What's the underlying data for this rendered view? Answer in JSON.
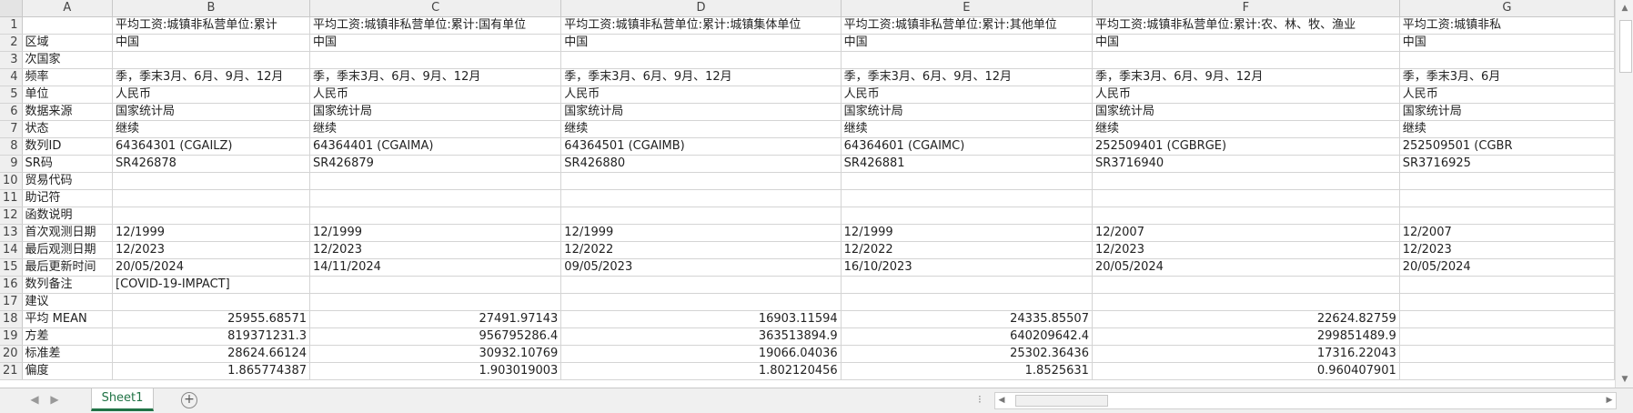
{
  "columns": [
    "A",
    "B",
    "C",
    "D",
    "E",
    "F",
    "G"
  ],
  "rows": [
    {
      "n": "1",
      "cells": [
        "",
        "平均工资:城镇非私营单位:累计",
        "平均工资:城镇非私营单位:累计:国有单位",
        "平均工资:城镇非私营单位:累计:城镇集体单位",
        "平均工资:城镇非私营单位:累计:其他单位",
        "平均工资:城镇非私营单位:累计:农、林、牧、渔业",
        "平均工资:城镇非私"
      ]
    },
    {
      "n": "2",
      "cells": [
        "区域",
        "中国",
        "中国",
        "中国",
        "中国",
        "中国",
        "中国"
      ]
    },
    {
      "n": "3",
      "cells": [
        "次国家",
        "",
        "",
        "",
        "",
        "",
        ""
      ]
    },
    {
      "n": "4",
      "cells": [
        "频率",
        "季，季末3月、6月、9月、12月",
        "季，季末3月、6月、9月、12月",
        "季，季末3月、6月、9月、12月",
        "季，季末3月、6月、9月、12月",
        "季，季末3月、6月、9月、12月",
        "季，季末3月、6月"
      ]
    },
    {
      "n": "5",
      "cells": [
        "单位",
        "人民币",
        "人民币",
        "人民币",
        "人民币",
        "人民币",
        "人民币"
      ]
    },
    {
      "n": "6",
      "cells": [
        "数据来源",
        "国家统计局",
        "国家统计局",
        "国家统计局",
        "国家统计局",
        "国家统计局",
        "国家统计局"
      ]
    },
    {
      "n": "7",
      "cells": [
        "状态",
        "继续",
        "继续",
        "继续",
        "继续",
        "继续",
        "继续"
      ]
    },
    {
      "n": "8",
      "cells": [
        "数列ID",
        "64364301 (CGAILZ)",
        "64364401 (CGAIMA)",
        "64364501 (CGAIMB)",
        "64364601 (CGAIMC)",
        "252509401 (CGBRGE)",
        "252509501 (CGBR"
      ]
    },
    {
      "n": "9",
      "cells": [
        "SR码",
        "SR426878",
        "SR426879",
        "SR426880",
        "SR426881",
        "SR3716940",
        "SR3716925"
      ]
    },
    {
      "n": "10",
      "cells": [
        "贸易代码",
        "",
        "",
        "",
        "",
        "",
        ""
      ]
    },
    {
      "n": "11",
      "cells": [
        "助记符",
        "",
        "",
        "",
        "",
        "",
        ""
      ]
    },
    {
      "n": "12",
      "cells": [
        "函数说明",
        "",
        "",
        "",
        "",
        "",
        ""
      ]
    },
    {
      "n": "13",
      "cells": [
        "首次观测日期",
        "12/1999",
        "12/1999",
        "12/1999",
        "12/1999",
        "12/2007",
        "12/2007"
      ]
    },
    {
      "n": "14",
      "cells": [
        "最后观测日期",
        "12/2023",
        "12/2023",
        "12/2022",
        "12/2022",
        "12/2023",
        "12/2023"
      ]
    },
    {
      "n": "15",
      "cells": [
        "最后更新时间",
        "20/05/2024",
        "14/11/2024",
        "09/05/2023",
        "16/10/2023",
        "20/05/2024",
        "20/05/2024"
      ]
    },
    {
      "n": "16",
      "cells": [
        "数列备注",
        "[COVID-19-IMPACT]",
        "",
        "",
        "",
        "",
        ""
      ]
    },
    {
      "n": "17",
      "cells": [
        "建议",
        "",
        "",
        "",
        "",
        "",
        ""
      ]
    },
    {
      "n": "18",
      "cells": [
        "平均 MEAN",
        "25955.68571",
        "27491.97143",
        "16903.11594",
        "24335.85507",
        "22624.82759",
        ""
      ]
    },
    {
      "n": "19",
      "cells": [
        "方差",
        "819371231.3",
        "956795286.4",
        "363513894.9",
        "640209642.4",
        "299851489.9",
        ""
      ]
    },
    {
      "n": "20",
      "cells": [
        "标准差",
        "28624.66124",
        "30932.10769",
        "19066.04036",
        "25302.36436",
        "17316.22043",
        ""
      ]
    },
    {
      "n": "21",
      "cells": [
        "偏度",
        "1.865774387",
        "1.903019003",
        "1.802120456",
        "1.8525631",
        "0.960407901",
        ""
      ]
    }
  ],
  "numeric_rows": [
    "18",
    "19",
    "20",
    "21"
  ],
  "sheet_tab": "Sheet1",
  "add_sheet": "+",
  "nav_prev": "◀",
  "nav_next": "▶",
  "scroll_dots": "⁝"
}
